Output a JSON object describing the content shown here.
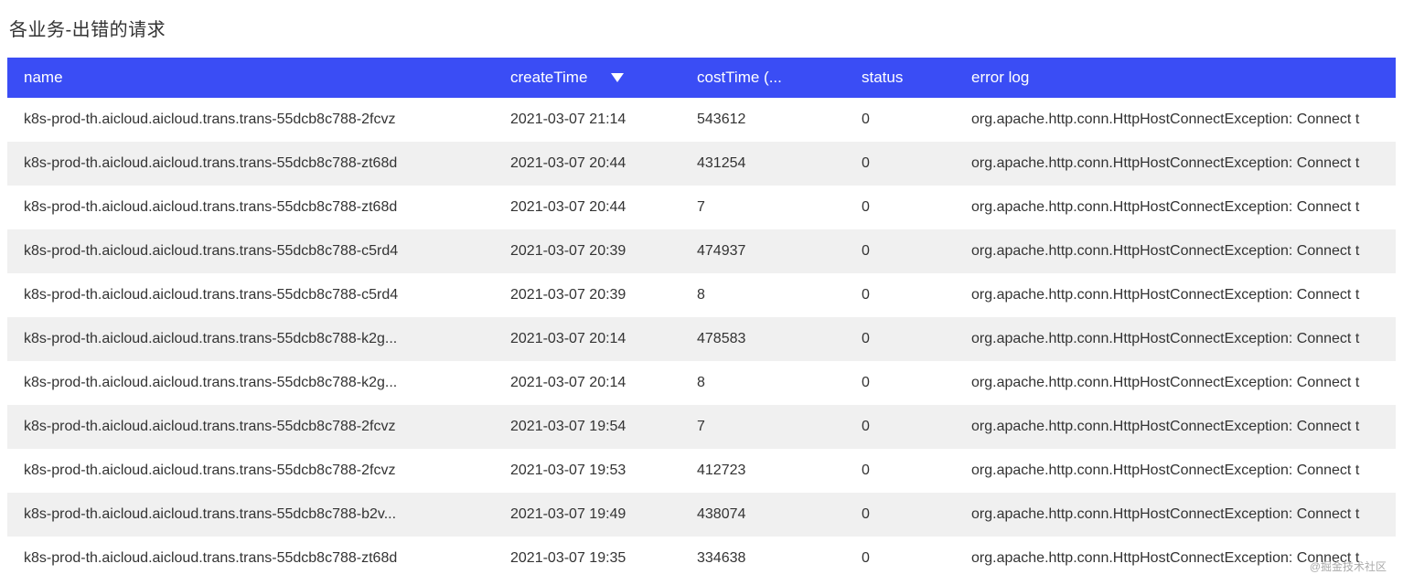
{
  "title": "各业务-出错的请求",
  "watermark": "@掘金技术社区",
  "columns": {
    "name": "name",
    "createTime": "createTime",
    "costTime": "costTime (...",
    "status": "status",
    "errorlog": "error log"
  },
  "rows": [
    {
      "name": "k8s-prod-th.aicloud.aicloud.trans.trans-55dcb8c788-2fcvz",
      "createTime": "2021-03-07 21:14",
      "costTime": "543612",
      "status": "0",
      "errorlog": "org.apache.http.conn.HttpHostConnectException: Connect t"
    },
    {
      "name": "k8s-prod-th.aicloud.aicloud.trans.trans-55dcb8c788-zt68d",
      "createTime": "2021-03-07 20:44",
      "costTime": "431254",
      "status": "0",
      "errorlog": "org.apache.http.conn.HttpHostConnectException: Connect t"
    },
    {
      "name": "k8s-prod-th.aicloud.aicloud.trans.trans-55dcb8c788-zt68d",
      "createTime": "2021-03-07 20:44",
      "costTime": "7",
      "status": "0",
      "errorlog": "org.apache.http.conn.HttpHostConnectException: Connect t"
    },
    {
      "name": "k8s-prod-th.aicloud.aicloud.trans.trans-55dcb8c788-c5rd4",
      "createTime": "2021-03-07 20:39",
      "costTime": "474937",
      "status": "0",
      "errorlog": "org.apache.http.conn.HttpHostConnectException: Connect t"
    },
    {
      "name": "k8s-prod-th.aicloud.aicloud.trans.trans-55dcb8c788-c5rd4",
      "createTime": "2021-03-07 20:39",
      "costTime": "8",
      "status": "0",
      "errorlog": "org.apache.http.conn.HttpHostConnectException: Connect t"
    },
    {
      "name": "k8s-prod-th.aicloud.aicloud.trans.trans-55dcb8c788-k2g...",
      "createTime": "2021-03-07 20:14",
      "costTime": "478583",
      "status": "0",
      "errorlog": "org.apache.http.conn.HttpHostConnectException: Connect t"
    },
    {
      "name": "k8s-prod-th.aicloud.aicloud.trans.trans-55dcb8c788-k2g...",
      "createTime": "2021-03-07 20:14",
      "costTime": "8",
      "status": "0",
      "errorlog": "org.apache.http.conn.HttpHostConnectException: Connect t"
    },
    {
      "name": "k8s-prod-th.aicloud.aicloud.trans.trans-55dcb8c788-2fcvz",
      "createTime": "2021-03-07 19:54",
      "costTime": "7",
      "status": "0",
      "errorlog": "org.apache.http.conn.HttpHostConnectException: Connect t"
    },
    {
      "name": "k8s-prod-th.aicloud.aicloud.trans.trans-55dcb8c788-2fcvz",
      "createTime": "2021-03-07 19:53",
      "costTime": "412723",
      "status": "0",
      "errorlog": "org.apache.http.conn.HttpHostConnectException: Connect t"
    },
    {
      "name": "k8s-prod-th.aicloud.aicloud.trans.trans-55dcb8c788-b2v...",
      "createTime": "2021-03-07 19:49",
      "costTime": "438074",
      "status": "0",
      "errorlog": "org.apache.http.conn.HttpHostConnectException: Connect t"
    },
    {
      "name": "k8s-prod-th.aicloud.aicloud.trans.trans-55dcb8c788-zt68d",
      "createTime": "2021-03-07 19:35",
      "costTime": "334638",
      "status": "0",
      "errorlog": "org.apache.http.conn.HttpHostConnectException: Connect t"
    }
  ]
}
